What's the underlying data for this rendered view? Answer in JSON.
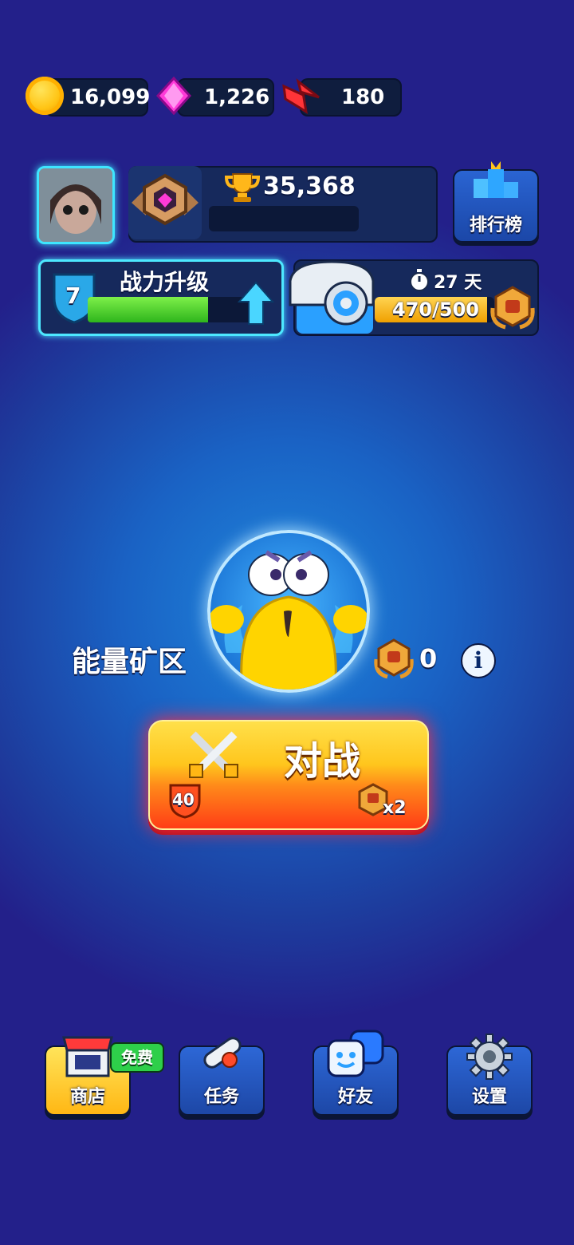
{
  "currencies": {
    "coins": {
      "value": "16,099",
      "icon": "gold-coin-icon"
    },
    "gems": {
      "value": "1,226",
      "icon": "pink-gem-icon"
    },
    "energy": {
      "value": "180",
      "icon": "red-bolt-icon"
    }
  },
  "profile": {
    "trophies": "35,368",
    "leaderboard_label": "排行榜"
  },
  "power_upgrade": {
    "label": "战力升级",
    "level": "7",
    "progress": 0.74
  },
  "pass": {
    "days_left": "27 天",
    "progress_text": "470/500",
    "progress": 0.94
  },
  "arena": {
    "name": "能量矿区",
    "medal_count": "0"
  },
  "battle_button": {
    "label": "对战",
    "cost": "40",
    "multiplier": "x2"
  },
  "nav": [
    {
      "label": "商店",
      "badge": "免费"
    },
    {
      "label": "任务"
    },
    {
      "label": "好友"
    },
    {
      "label": "设置"
    }
  ],
  "colors": {
    "accent_cyan": "#4de8ff",
    "battle_red": "#ff3d16",
    "progress_green": "#2eb51c"
  }
}
